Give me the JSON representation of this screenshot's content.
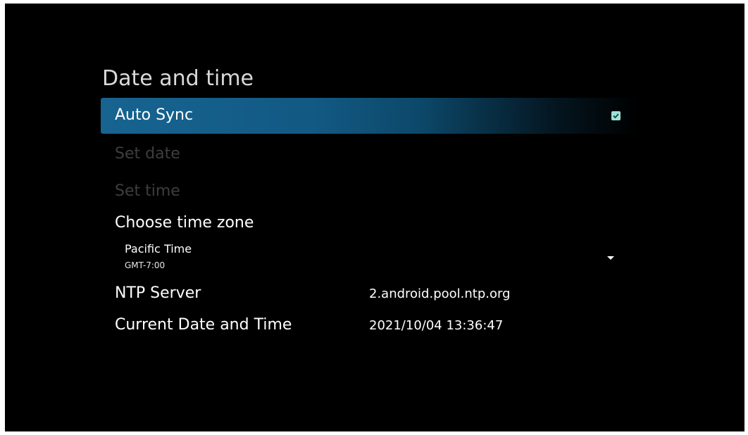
{
  "page": {
    "title": "Date and time"
  },
  "settings": {
    "auto_sync": {
      "label": "Auto Sync",
      "checked": true
    },
    "set_date": {
      "label": "Set date",
      "enabled": false
    },
    "set_time": {
      "label": "Set time",
      "enabled": false
    },
    "time_zone": {
      "label": "Choose time zone",
      "value": "Pacific Time",
      "offset": "GMT-7:00",
      "icon": "chevron-down-icon"
    }
  },
  "info": {
    "ntp_server": {
      "label": "NTP Server",
      "value": "2.android.pool.ntp.org"
    },
    "current_date_time": {
      "label": "Current Date and Time",
      "value": "2021/10/04 13:36:47"
    }
  },
  "colors": {
    "background": "#000000",
    "focus_highlight": "#176491",
    "checkbox_fill": "#9fe0d0",
    "disabled_text": "#3e3e3e"
  }
}
